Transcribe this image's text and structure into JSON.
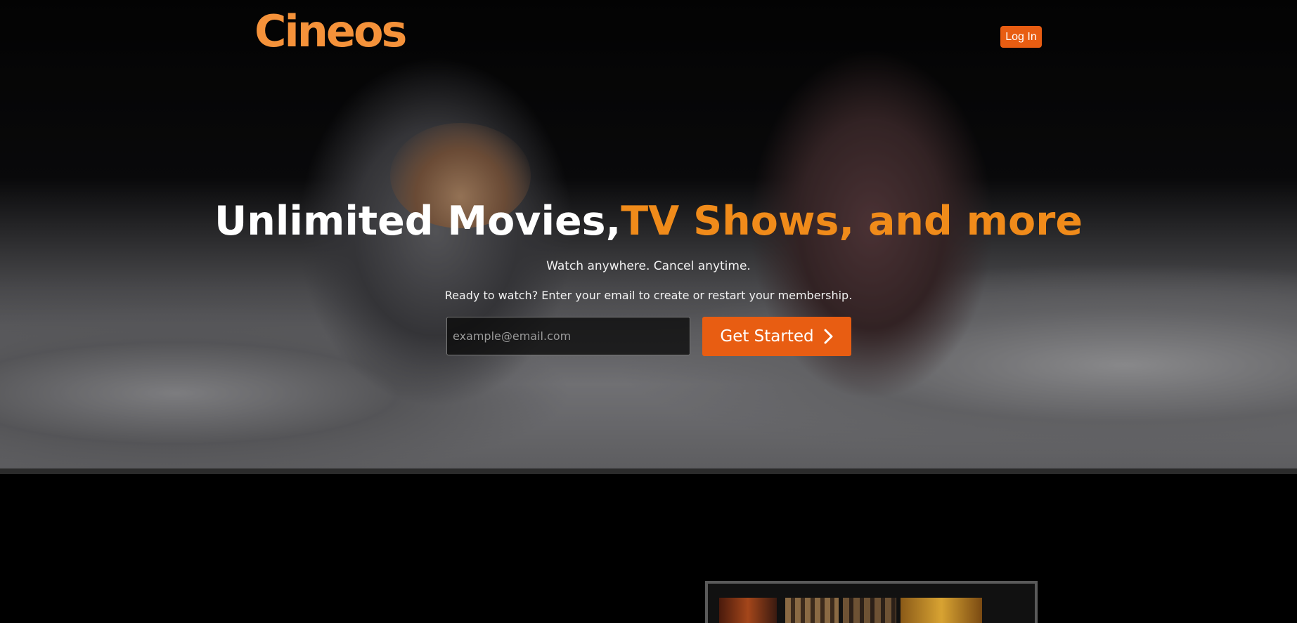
{
  "brand": {
    "name": "Cineos",
    "color": "#f5923a"
  },
  "header": {
    "login_label": "Log In"
  },
  "hero": {
    "headline_white": "Unlimited Movies,",
    "headline_orange": "TV Shows, and more",
    "subline": "Watch anywhere. Cancel anytime.",
    "cta_text": "Ready to watch? Enter your email to create or restart your membership.",
    "email_placeholder": "example@email.com",
    "start_button_label": "Get Started",
    "start_button_icon": "chevron-right-icon"
  },
  "colors": {
    "accent": "#e85d12",
    "headline_orange": "#f08b1a",
    "background": "#000000"
  }
}
